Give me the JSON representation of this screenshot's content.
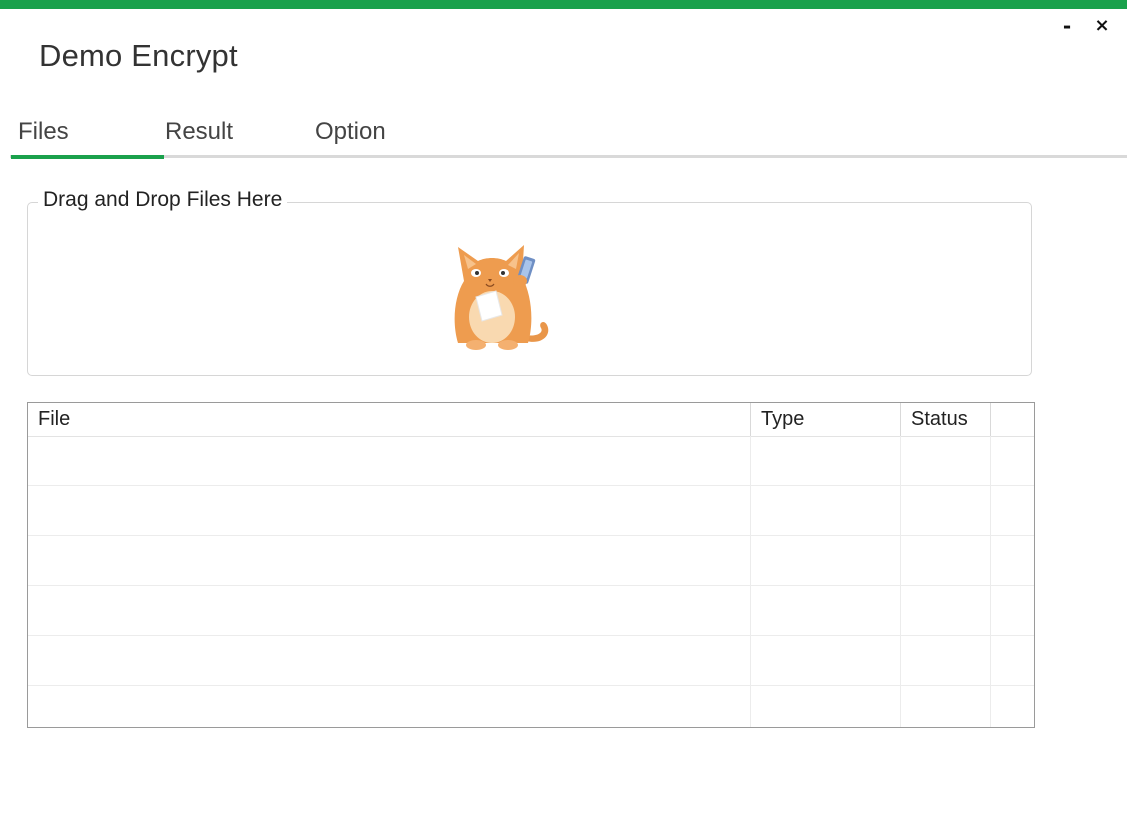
{
  "window": {
    "title": "Demo Encrypt",
    "minimize_glyph": "-",
    "close_glyph": "×",
    "accent_color": "#1aa14c"
  },
  "tabs": [
    {
      "label": "Files",
      "active": true
    },
    {
      "label": "Result",
      "active": false
    },
    {
      "label": "Option",
      "active": false
    }
  ],
  "dropzone": {
    "legend": "Drag and Drop Files Here",
    "illustration": "cat-with-phone-icon"
  },
  "grid": {
    "columns": [
      "File",
      "Type",
      "Status",
      ""
    ],
    "rows": []
  }
}
